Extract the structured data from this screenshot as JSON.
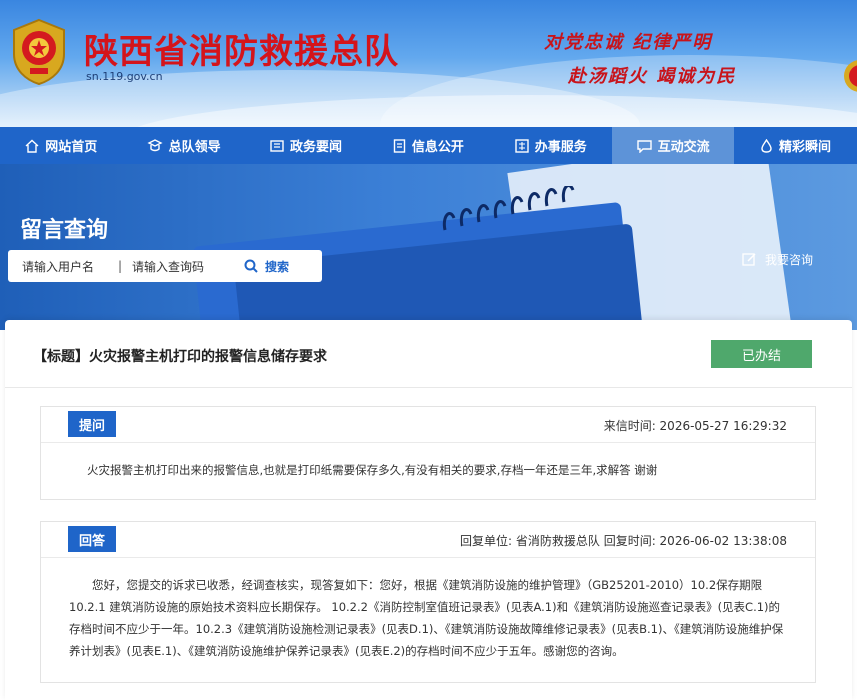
{
  "header": {
    "site_title": "陕西省消防救援总队",
    "domain": "sn.119.gov.cn",
    "slogan_line1": "对党忠诚 纪律严明",
    "slogan_line2": "赴汤蹈火 竭诚为民",
    "title_color": "#d4141b",
    "banner_color": "#3a86e0"
  },
  "nav": {
    "items": [
      {
        "label": "网站首页",
        "icon": "home-icon"
      },
      {
        "label": "总队领导",
        "icon": "leaders-icon"
      },
      {
        "label": "政务要闻",
        "icon": "news-icon"
      },
      {
        "label": "信息公开",
        "icon": "document-icon"
      },
      {
        "label": "办事服务",
        "icon": "service-icon"
      },
      {
        "label": "互动交流",
        "icon": "chat-icon"
      },
      {
        "label": "精彩瞬间",
        "icon": "flame-icon"
      }
    ],
    "active_index": 5,
    "bar_color": "#1f65c9"
  },
  "hero": {
    "title": "留言查询",
    "search": {
      "username_placeholder": "请输入用户名",
      "separator": "|",
      "code_placeholder": "请输入查询码",
      "button_label": "搜索"
    },
    "ask_label": "我要咨询"
  },
  "topic": {
    "title": "【标题】火灾报警主机打印的报警信息储存要求",
    "status": "已办结",
    "status_color": "#4fa86c"
  },
  "question": {
    "tag": "提问",
    "meta": "来信时间:  2026-05-27 16:29:32",
    "body": "火灾报警主机打印出来的报警信息,也就是打印纸需要保存多久,有没有相关的要求,存档一年还是三年,求解答 谢谢"
  },
  "answer": {
    "tag": "回答",
    "meta": "回复单位:  省消防救援总队 回复时间:  2026-06-02 13:38:08",
    "body": "您好，您提交的诉求已收悉，经调查核实，现答复如下：您好，根据《建筑消防设施的维护管理》（GB25201-2010）10.2保存期限 10.2.1 建筑消防设施的原始技术资料应长期保存。 10.2.2《消防控制室值班记录表》(见表A.1)和《建筑消防设施巡查记录表》(见表C.1)的存档时间不应少于一年。10.2.3《建筑消防设施检测记录表》(见表D.1)、《建筑消防设施故障维修记录表》(见表B.1)、《建筑消防设施维护保养计划表》(见表E.1)、《建筑消防设施维护保养记录表》(见表E.2)的存档时间不应少于五年。感谢您的咨询。"
  }
}
